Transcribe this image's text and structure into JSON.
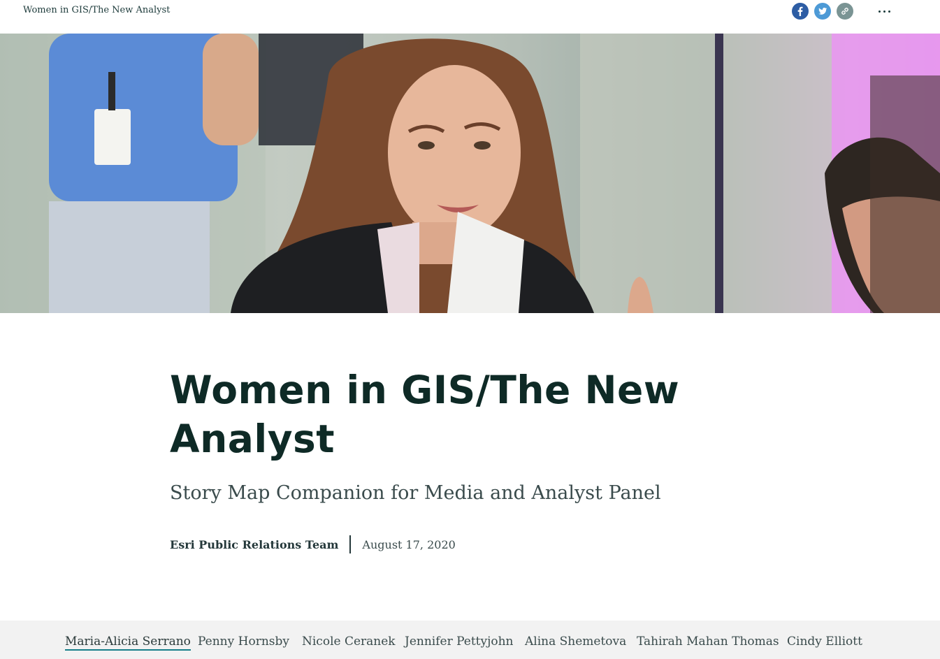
{
  "header": {
    "title": "Women in GIS/The New Analyst",
    "share": {
      "facebook_icon": "facebook-icon",
      "twitter_icon": "twitter-icon",
      "link_icon": "link-icon",
      "more_icon": "more-horizontal-icon"
    }
  },
  "hero": {
    "image": "photo-woman-at-event"
  },
  "story": {
    "title": "Women in GIS/The New Analyst",
    "subtitle": "Story Map Companion for Media and Analyst Panel",
    "author": "Esri Public Relations Team",
    "date": "August 17, 2020"
  },
  "nav": {
    "items": [
      {
        "label": "Maria-Alicia Serrano",
        "active": true
      },
      {
        "label": "Penny Hornsby"
      },
      {
        "label": "Nicole Ceranek"
      },
      {
        "label": "Jennifer Pettyjohn"
      },
      {
        "label": "Alina Shemetova"
      },
      {
        "label": "Tahirah Mahan Thomas"
      },
      {
        "label": "Cindy Elliott"
      }
    ]
  },
  "colors": {
    "title": "#0e2a26",
    "accent_underline": "#177e89",
    "facebook": "#2d5da4",
    "twitter": "#4d9ad6",
    "link": "#7a9494",
    "nav_background": "#f2f2f2"
  }
}
